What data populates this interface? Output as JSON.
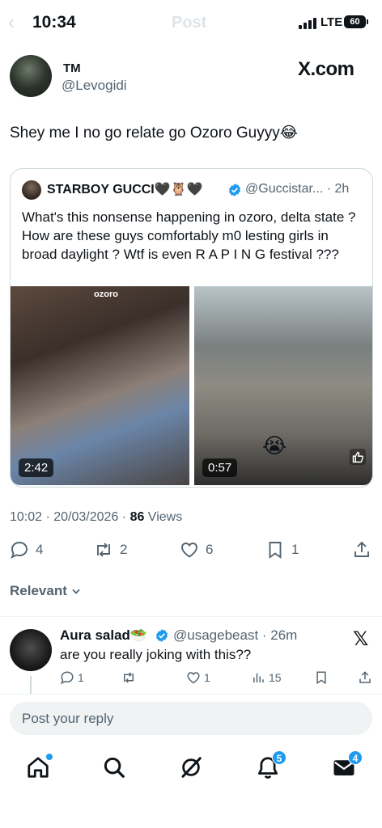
{
  "status_bar": {
    "time": "10:34",
    "ghost_back": "‹",
    "ghost_title": "Post",
    "network": "LTE",
    "battery": "60"
  },
  "tweet": {
    "author_name": "TM",
    "author_handle": "@Levogidi",
    "source_watermark": "X.com",
    "text": "Shey me I no go relate go Ozoro Guyyy😂",
    "timestamp": "10:02 · 20/03/2026 · ",
    "views_count": "86",
    "views_label": " Views",
    "replies": "4",
    "reposts": "2",
    "likes": "6",
    "bookmarks": "1"
  },
  "quoted": {
    "author_name": "STARBOY GUCCI🖤🦉🖤",
    "handle_time": "@Guccistar... · 2h",
    "text": "What's this nonsense happening in ozoro, delta state ? How are these guys comfortably m0 lesting girls in broad daylight ? Wtf is even R A P I N G festival ???",
    "media": [
      {
        "duration": "2:42",
        "caption": "ozoro"
      },
      {
        "duration": "0:57",
        "emoji": "😭"
      }
    ]
  },
  "sort": {
    "label": "Relevant"
  },
  "reply": {
    "name": "Aura salad🥗",
    "handle_time": "@usagebeast · 26m",
    "x_mark": "𝕏",
    "text": "are you really joking with this??",
    "replies": "1",
    "reposts": "",
    "likes": "1",
    "views": "15"
  },
  "reply_box": {
    "placeholder": "Post your reply"
  },
  "nav": {
    "notifications_badge": "5",
    "messages_badge": "4"
  },
  "colors": {
    "accent": "#1d9bf0",
    "text": "#0f1419",
    "secondary": "#536471"
  }
}
